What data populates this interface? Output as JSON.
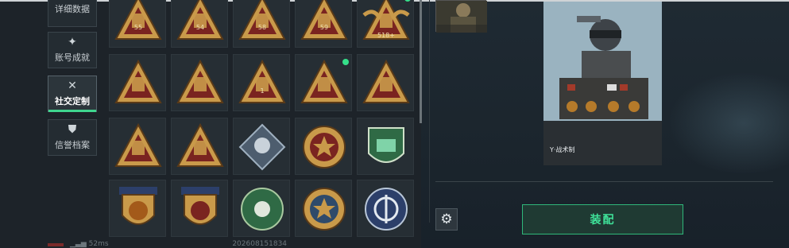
{
  "sidebar": {
    "items": [
      {
        "label": "详细数据",
        "icon": "stats-icon"
      },
      {
        "label": "账号成就",
        "icon": "achievement-icon"
      },
      {
        "label": "社交定制",
        "icon": "tools-icon",
        "active": true
      },
      {
        "label": "信誉档案",
        "icon": "shield-icon"
      }
    ]
  },
  "badges": {
    "rows": [
      [
        "55",
        "54",
        "58",
        "59",
        "518+"
      ],
      [
        "",
        "",
        "1",
        "",
        ""
      ],
      [
        "",
        "",
        "",
        "",
        ""
      ],
      [
        "",
        "",
        "",
        "",
        ""
      ]
    ],
    "new_dots": [
      {
        "row": 0,
        "col": 4
      },
      {
        "row": 1,
        "col": 3
      }
    ]
  },
  "preview": {
    "card_label": "Y·战术制",
    "equip_label": "装配"
  },
  "status": {
    "ping": "52ms",
    "build": "202608151834"
  },
  "colors": {
    "accent": "#3fe39a",
    "badge_gold": "#c99a4a",
    "badge_red": "#7a2420"
  }
}
